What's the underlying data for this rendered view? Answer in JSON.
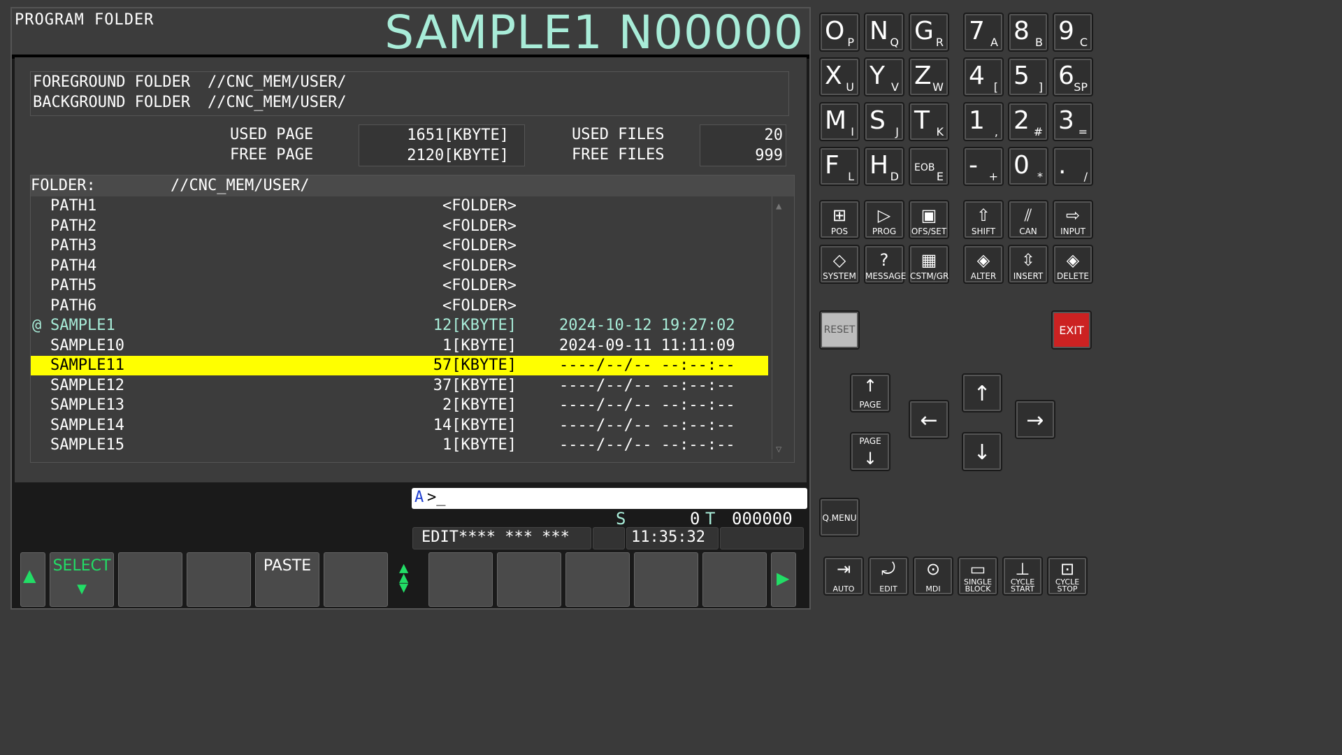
{
  "title": {
    "left": "PROGRAM FOLDER",
    "right": "SAMPLE1 N00000"
  },
  "folders": {
    "fg_label": "FOREGROUND FOLDER",
    "fg_value": "//CNC_MEM/USER/",
    "bg_label": "BACKGROUND FOLDER",
    "bg_value": "//CNC_MEM/USER/"
  },
  "stats": {
    "used_page_label": "USED PAGE",
    "used_page": "1651[KBYTE]",
    "free_page_label": "FREE PAGE",
    "free_page": "2120[KBYTE]",
    "used_files_label": "USED FILES",
    "used_files": "20",
    "free_files_label": "FREE FILES",
    "free_files": "999"
  },
  "list": {
    "header_label": "FOLDER:",
    "header_path": "//CNC_MEM/USER/",
    "rows": [
      {
        "name": "PATH1",
        "size": "<FOLDER>",
        "date": ""
      },
      {
        "name": "PATH2",
        "size": "<FOLDER>",
        "date": ""
      },
      {
        "name": "PATH3",
        "size": "<FOLDER>",
        "date": ""
      },
      {
        "name": "PATH4",
        "size": "<FOLDER>",
        "date": ""
      },
      {
        "name": "PATH5",
        "size": "<FOLDER>",
        "date": ""
      },
      {
        "name": "PATH6",
        "size": "<FOLDER>",
        "date": ""
      },
      {
        "mark": "@",
        "name": "SAMPLE1",
        "size": "12[KBYTE]",
        "date": "2024-10-12 19:27:02"
      },
      {
        "name": "SAMPLE10",
        "size": "1[KBYTE]",
        "date": "2024-09-11 11:11:09"
      },
      {
        "name": "SAMPLE11",
        "size": "57[KBYTE]",
        "date": "----/--/-- --:--:--"
      },
      {
        "name": "SAMPLE12",
        "size": "37[KBYTE]",
        "date": "----/--/-- --:--:--"
      },
      {
        "name": "SAMPLE13",
        "size": "2[KBYTE]",
        "date": "----/--/-- --:--:--"
      },
      {
        "name": "SAMPLE14",
        "size": "14[KBYTE]",
        "date": "----/--/-- --:--:--"
      },
      {
        "name": "SAMPLE15",
        "size": "1[KBYTE]",
        "date": "----/--/-- --:--:--"
      }
    ]
  },
  "input": {
    "prefix": "A",
    "prompt": ">_"
  },
  "status": {
    "s_label": "S",
    "s_value": "0",
    "t_label": "T",
    "t_value": "000000",
    "mode": "EDIT**** *** ***",
    "clock": "11:35:32"
  },
  "softkeys": {
    "select": "SELECT",
    "paste": "PASTE"
  },
  "keypad": {
    "letters": [
      [
        "O",
        "P"
      ],
      [
        "N",
        "Q"
      ],
      [
        "G",
        "R"
      ],
      [
        "X",
        "U"
      ],
      [
        "Y",
        "V"
      ],
      [
        "Z",
        "W"
      ],
      [
        "M",
        "I"
      ],
      [
        "S",
        "J"
      ],
      [
        "T",
        "K"
      ],
      [
        "F",
        "L"
      ],
      [
        "H",
        "D"
      ],
      [
        "EOB",
        "E"
      ]
    ],
    "digits": [
      [
        "7",
        "A"
      ],
      [
        "8",
        "B"
      ],
      [
        "9",
        "C"
      ],
      [
        "4",
        "["
      ],
      [
        "5",
        "]"
      ],
      [
        "6",
        "SP"
      ],
      [
        "1",
        ","
      ],
      [
        "2",
        "#"
      ],
      [
        "3",
        "="
      ],
      [
        "-",
        "+"
      ],
      [
        "0",
        "*"
      ],
      [
        ".",
        "/"
      ]
    ],
    "func": [
      "POS",
      "PROG",
      "OFS/SET",
      "SHIFT",
      "CAN",
      "INPUT",
      "SYSTEM",
      "MESSAGE",
      "CSTM/GR",
      "ALTER",
      "INSERT",
      "DELETE"
    ],
    "reset": "RESET",
    "exit": "EXIT",
    "page": "PAGE",
    "qmenu": "Q.MENU",
    "modes": [
      "AUTO",
      "EDIT",
      "MDI",
      "SINGLE BLOCK",
      "CYCLE START",
      "CYCLE STOP"
    ]
  },
  "colors": {
    "accent": "#a8ecd8",
    "highlight": "#ffff00",
    "softkey_green": "#22dd66",
    "exit_red": "#cc2222"
  }
}
